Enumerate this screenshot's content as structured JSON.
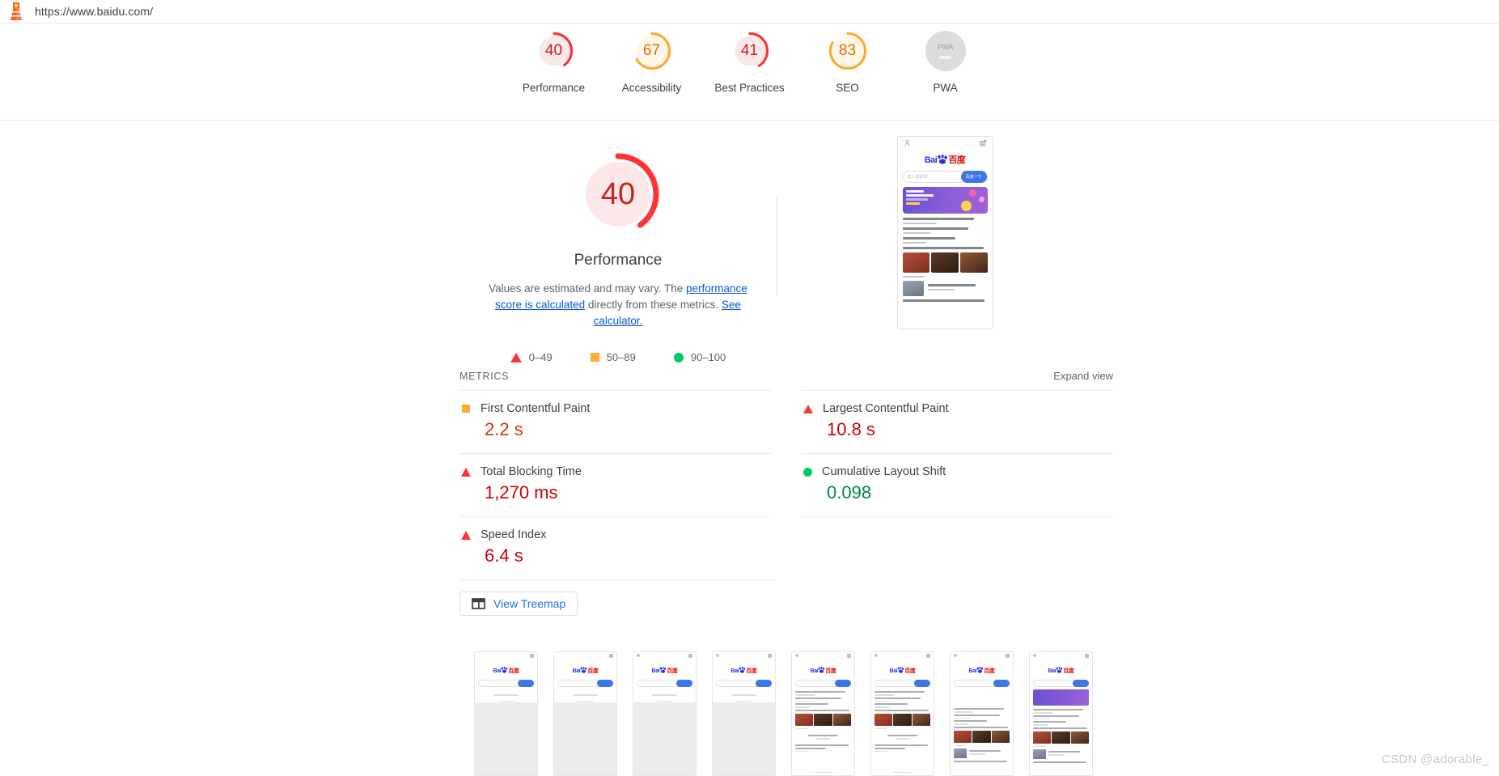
{
  "topbar": {
    "logo_icon": "lighthouse-icon",
    "url": "https://www.baidu.com/"
  },
  "gauges": [
    {
      "label": "Performance",
      "score": "40",
      "color": "#f33",
      "bg": "#fce8e9",
      "pct": 40
    },
    {
      "label": "Accessibility",
      "score": "67",
      "color": "#fa3",
      "bg": "#fef6e6",
      "pct": 67
    },
    {
      "label": "Best Practices",
      "score": "41",
      "color": "#f33",
      "bg": "#fce8e9",
      "pct": 41
    },
    {
      "label": "SEO",
      "score": "83",
      "color": "#fa3",
      "bg": "#fef6e6",
      "pct": 83
    },
    {
      "label": "PWA",
      "score": "PWA",
      "color": "#dcdcdc",
      "bg": "#dcdcdc",
      "pct": 0
    }
  ],
  "performance": {
    "score": "40",
    "score_color": "#c7221f",
    "arc_color": "#f33",
    "arc_bg": "#fce8e9",
    "title": "Performance",
    "desc_part1": "Values are estimated and may vary. The ",
    "desc_link1": "performance score is calculated",
    "desc_part2": " directly from these metrics. ",
    "desc_link2": "See calculator."
  },
  "legend": [
    {
      "shape": "triangle",
      "label": "0–49",
      "color": "#f33"
    },
    {
      "shape": "square",
      "label": "50–89",
      "color": "#fa3"
    },
    {
      "shape": "circle",
      "label": "90–100",
      "color": "#0c6"
    }
  ],
  "metrics_section": {
    "title": "METRICS",
    "expand_label": "Expand view"
  },
  "metrics": [
    {
      "name": "First Contentful Paint",
      "value": "2.2 s",
      "icon": "square",
      "value_color": "#d93502"
    },
    {
      "name": "Largest Contentful Paint",
      "value": "10.8 s",
      "icon": "triangle",
      "value_color": "#cc0000"
    },
    {
      "name": "Total Blocking Time",
      "value": "1,270 ms",
      "icon": "triangle",
      "value_color": "#cc0000"
    },
    {
      "name": "Cumulative Layout Shift",
      "value": "0.098",
      "icon": "circle",
      "value_color": "#018642"
    },
    {
      "name": "Speed Index",
      "value": "6.4 s",
      "icon": "triangle",
      "value_color": "#cc0000"
    }
  ],
  "treemap": {
    "icon": "treemap-icon",
    "label": "View Treemap"
  },
  "final_screenshot": {
    "alt": "Baidu mobile homepage final screenshot",
    "logo_bai": "Bai",
    "logo_du": "百度",
    "search_placeholder": "输入搜索词",
    "search_button": "百度一下",
    "headlines": [
      "中央军委举行晋升上将军衔仪式",
      "和命之重｜活外之外 中式舒适",
      "年度盘点｜2023 有一种！",
      "韩国过口中国陈威宾台纪录，对中国也是警示！",
      "中央批准，营荣荣服务",
      "美国\"堕人言论\"，激活国并次有号！预计不单此"
    ]
  },
  "filmstrip": {
    "frame_count": 8,
    "frames": [
      {
        "stage": "blank-search"
      },
      {
        "stage": "blank-search"
      },
      {
        "stage": "blank-search"
      },
      {
        "stage": "blank-search"
      },
      {
        "stage": "content-partial"
      },
      {
        "stage": "content-partial"
      },
      {
        "stage": "content-more"
      },
      {
        "stage": "content-full"
      }
    ]
  },
  "watermark": {
    "text": "CSDN @adorable_"
  }
}
